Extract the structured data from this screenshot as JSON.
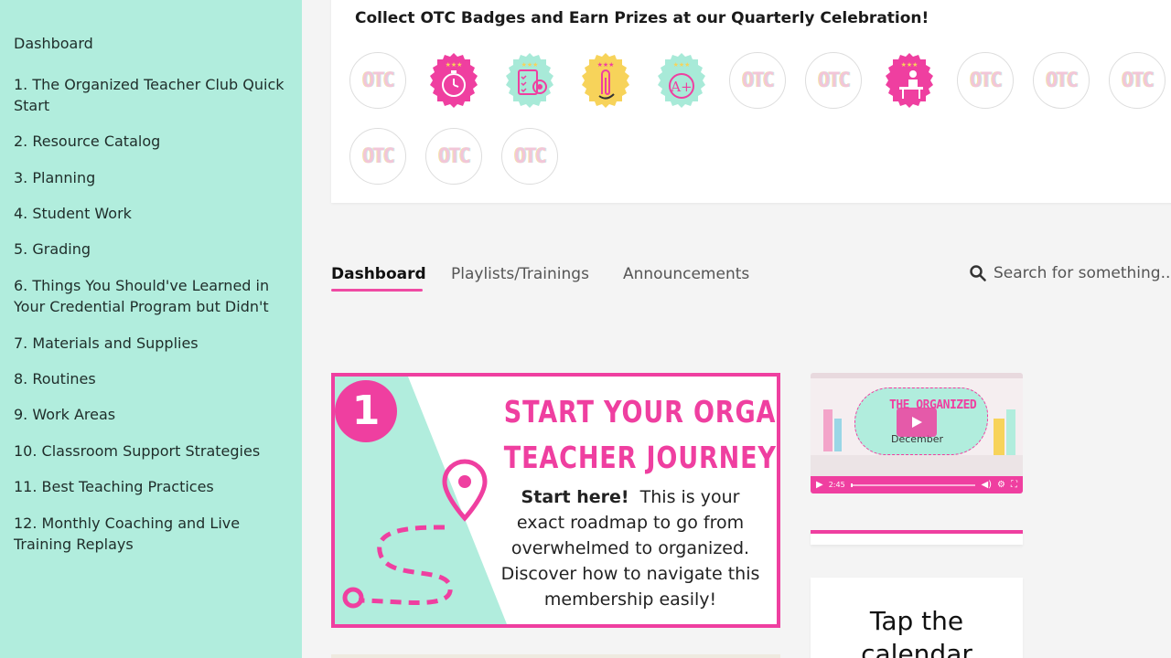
{
  "sidebar": {
    "items": [
      {
        "label": "Dashboard"
      },
      {
        "label": "1. The Organized Teacher Club Quick Start"
      },
      {
        "label": "2. Resource Catalog"
      },
      {
        "label": "3. Planning"
      },
      {
        "label": "4. Student Work"
      },
      {
        "label": "5. Grading"
      },
      {
        "label": "6. Things You Should've Learned in Your Credential Program but Didn't"
      },
      {
        "label": "7. Materials and Supplies"
      },
      {
        "label": "8. Routines"
      },
      {
        "label": "9. Work Areas"
      },
      {
        "label": "10. Classroom Support Strategies"
      },
      {
        "label": "11. Best Teaching Practices"
      },
      {
        "label": "12. Monthly Coaching and Live Training Replays"
      }
    ]
  },
  "badges": {
    "title": "Collect OTC Badges and Earn Prizes at our Quarterly Celebration!",
    "locked_text": "OTC",
    "items": [
      {
        "state": "locked"
      },
      {
        "state": "earned",
        "icon": "stopwatch-icon",
        "color": "#ef3fa0"
      },
      {
        "state": "earned",
        "icon": "checklist-target-icon",
        "color": "#a8ead8"
      },
      {
        "state": "earned",
        "icon": "paperclip-icon",
        "color": "#f7d35a"
      },
      {
        "state": "earned",
        "icon": "a-plus-icon",
        "color": "#a8ead8"
      },
      {
        "state": "locked"
      },
      {
        "state": "locked"
      },
      {
        "state": "earned",
        "icon": "student-desk-icon",
        "color": "#ef3fa0"
      },
      {
        "state": "locked"
      },
      {
        "state": "locked"
      },
      {
        "state": "locked"
      },
      {
        "state": "locked"
      },
      {
        "state": "locked"
      },
      {
        "state": "locked"
      }
    ]
  },
  "tabs": [
    {
      "label": "Dashboard",
      "active": true
    },
    {
      "label": "Playlists/Trainings",
      "active": false
    },
    {
      "label": "Announcements",
      "active": false
    }
  ],
  "search": {
    "placeholder": "Search for something..."
  },
  "journey": {
    "number": "1",
    "headline_1": "START YOUR ORGANIZED",
    "headline_2": "TEACHER JOURNEY HERE",
    "lead": "Start here!",
    "body": "This is your exact roadmap to go from overwhelmed to organized. Discover how to navigate this membership easily!"
  },
  "video": {
    "logo_text": "THE ORGANIZED",
    "subtitle": "December",
    "time": "2:45",
    "progress": 0.02
  },
  "calendar_card": {
    "text": "Tap the calendar"
  },
  "colors": {
    "accent": "#ef3fa0",
    "mint": "#b1eddd"
  }
}
